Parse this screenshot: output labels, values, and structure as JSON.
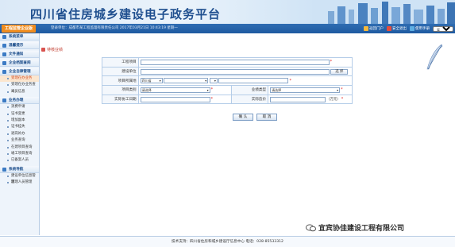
{
  "banner": {
    "title": "四川省住房城乡建设电子政务平台"
  },
  "topbar": {
    "system_tab": "工程监管企业版",
    "login_info": "登录单位：成都市某工程监理有限责任公司   2017年03月21日 10:43:19 星期一",
    "actions": [
      {
        "label": "返回门户",
        "icon": "home-icon"
      },
      {
        "label": "安全退出",
        "icon": "exit-icon"
      },
      {
        "label": "使用手册",
        "icon": "book-icon"
      }
    ],
    "role_select": "实用版"
  },
  "sidebar": {
    "title": "系统菜单",
    "sections": [
      {
        "header": "温馨提示",
        "items": []
      },
      {
        "header": "文件通知",
        "items": []
      },
      {
        "header": "企业档案查阅",
        "items": []
      },
      {
        "header": "企业自律管理",
        "items": [
          "受理在办业务",
          "受理在办业务查询",
          "人员信息"
        ]
      },
      {
        "header": "业务办理",
        "items": [
          "消费申请",
          "证书变更",
          "增加副本",
          "证书挂失",
          "退岗补办",
          "业务查询",
          "在建项目查询",
          "竣工项目查询",
          "已备案人员"
        ]
      },
      {
        "header": "系统导航",
        "items": [
          "建设单位信息管理",
          "监理人员管理"
        ]
      }
    ],
    "active_item": "受理在办业务"
  },
  "main": {
    "tab_label": "待核业绩",
    "form": {
      "project_name_label": "工程项目",
      "builder_label": "建设单位",
      "select_button": "选 择",
      "location_label": "项目所属地",
      "province_value": "四川省",
      "category_label": "项目类别",
      "category_value": "请选择",
      "biz_type_label": "业绩类型",
      "biz_type_value": "请选择",
      "period_label": "实际协工日期",
      "price_label": "实际造价",
      "price_unit": "（万元）"
    },
    "confirm_button": "确 认",
    "cancel_button": "取 消"
  },
  "watermark": "宜宾协佳建设工程有限公司",
  "footer": "技术支持：四川省住房和城乡建设厅信息中心   电话：028-85533312",
  "colors": {
    "brand": "#1f4f8f",
    "accent": "#f08c1e",
    "required": "#e02020"
  }
}
